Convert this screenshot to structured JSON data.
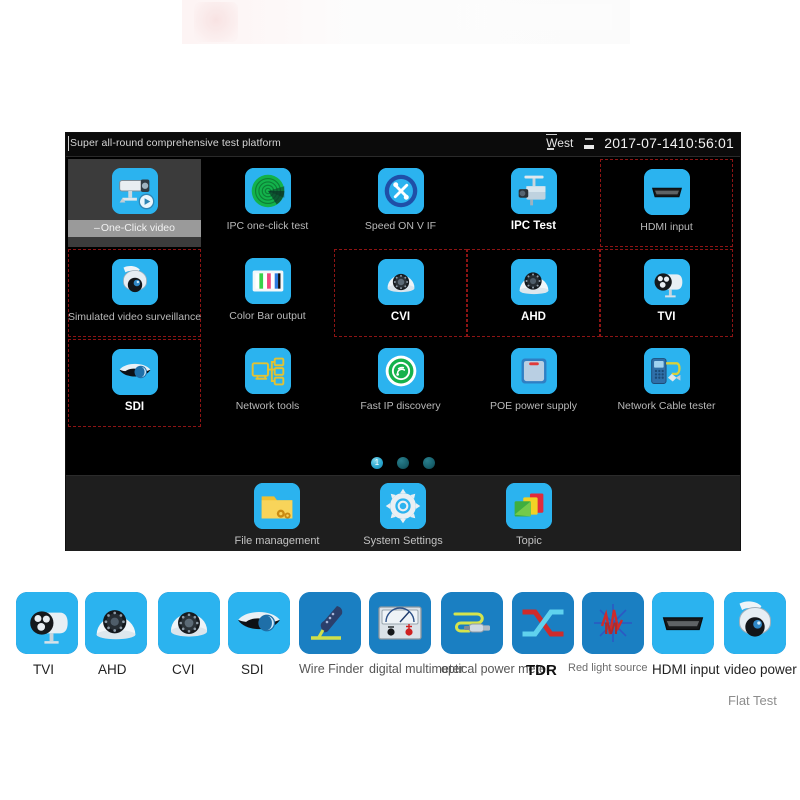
{
  "window": {
    "title": "Super all-round comprehensive test platform",
    "region": "West",
    "datetime": "2017-07-1410:56:01",
    "sd_icon": "sd-card-icon"
  },
  "desktop": {
    "rows": [
      [
        {
          "label": "One-Click video",
          "icon": "bullet-camera-play-icon",
          "state": "selected"
        },
        {
          "label": "IPC one-click test",
          "icon": "radar-scan-icon",
          "state": "normal"
        },
        {
          "label": "Speed ON V IF",
          "icon": "onvif-tools-icon",
          "state": "normal"
        },
        {
          "label": "IPC Test",
          "icon": "ipc-camera-mount-icon",
          "state": "bold"
        },
        {
          "label": "HDMI input",
          "icon": "hdmi-port-icon",
          "state": "dashed"
        }
      ],
      [
        {
          "label": "Simulated video surveillance",
          "icon": "ptz-dome-icon",
          "state": "dashed"
        },
        {
          "label": "Color Bar output",
          "icon": "color-bars-icon",
          "state": "normal"
        },
        {
          "label": "CVI",
          "icon": "turret-camera-icon",
          "state": "dashed-bold"
        },
        {
          "label": "AHD",
          "icon": "dome-camera-icon",
          "state": "dashed-bold"
        },
        {
          "label": "TVI",
          "icon": "bullet-camera-icon",
          "state": "dashed-bold"
        }
      ],
      [
        {
          "label": "SDI",
          "icon": "eye-dome-icon",
          "state": "dashed-bold"
        },
        {
          "label": "Network tools",
          "icon": "network-topology-icon",
          "state": "normal"
        },
        {
          "label": "Fast IP discovery",
          "icon": "ip-discovery-icon",
          "state": "normal"
        },
        {
          "label": "POE power supply",
          "icon": "poe-switch-icon",
          "state": "normal"
        },
        {
          "label": "Network Cable tester",
          "icon": "cable-tester-icon",
          "state": "normal"
        }
      ]
    ],
    "pager": {
      "total": 3,
      "active_index": 0,
      "active_label": "1"
    },
    "dock": [
      {
        "label": "File management",
        "icon": "folder-gear-icon"
      },
      {
        "label": "System Settings",
        "icon": "gear-icon"
      },
      {
        "label": "Topic",
        "icon": "theme-cards-icon"
      }
    ]
  },
  "toolstrip": {
    "items": [
      {
        "label": "TVI",
        "icon": "bullet-camera-icon",
        "style": "mid"
      },
      {
        "label": "AHD",
        "icon": "dome-camera-icon",
        "style": "mid"
      },
      {
        "label": "CVI",
        "icon": "turret-camera-icon",
        "style": "mid"
      },
      {
        "label": "SDI",
        "icon": "eye-dome-icon",
        "style": "mid"
      },
      {
        "label": "Wire Finder",
        "icon": "wire-finder-icon",
        "style": "wrap"
      },
      {
        "label": "digital multimeter",
        "icon": "multimeter-icon",
        "style": "wrap"
      },
      {
        "label": "optical power meter",
        "icon": "optical-power-meter-icon",
        "style": "wrap"
      },
      {
        "label": "TDR",
        "icon": "tdr-crossover-icon",
        "style": "big"
      },
      {
        "label": "Red light source",
        "icon": "red-light-source-icon",
        "style": "gray"
      },
      {
        "label": "HDMI input",
        "icon": "hdmi-port-icon",
        "style": "mid"
      },
      {
        "label": "video power",
        "icon": "ptz-dome-icon",
        "style": "mid"
      }
    ],
    "footer": "Flat Test"
  },
  "colors": {
    "icon_blue": "#2bb3ef",
    "strip_blue": "#1a7fc2",
    "dashed_red": "#8d1414",
    "window_bg": "#050505",
    "dock_bg": "#1e1e1e"
  }
}
